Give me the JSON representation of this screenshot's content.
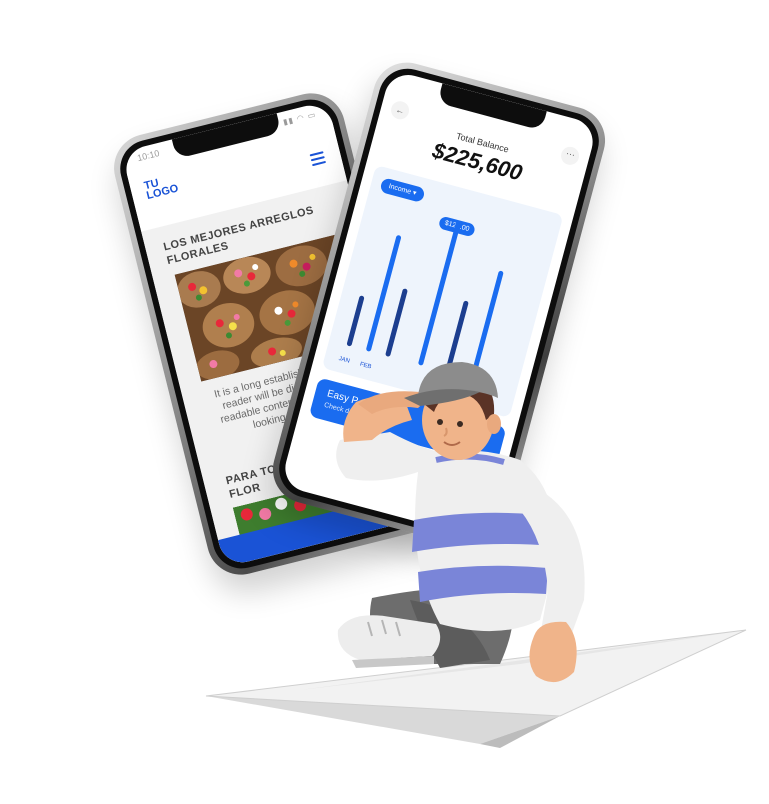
{
  "phone_flowers": {
    "status_time": "10:10",
    "logo": "TU LOGO",
    "menu_icon": "hamburger-menu-icon",
    "heading_1": "LOS MEJORES ARREGLOS FLORALES",
    "paragraph": "It is a long established fact that a reader will be distracted by the readable content of a page when looking at its layout.",
    "dots": "• • •",
    "heading_2": "PARA TODA OCASIÓN UNA FLOR",
    "chat_icon": "whatsapp-icon",
    "accent_color": "#1a53d6"
  },
  "phone_finance": {
    "back_icon": "arrow-left-icon",
    "more_icon": "more-dots-icon",
    "balance_label": "Total Balance",
    "balance_amount": "$225,600",
    "filter_label": "Income",
    "tooltip_value": "$120.00",
    "months": [
      "JAN",
      "FEB"
    ],
    "card_title": "Easy P",
    "card_subtitle": "Check d",
    "accent_color": "#1a6cf0"
  }
}
